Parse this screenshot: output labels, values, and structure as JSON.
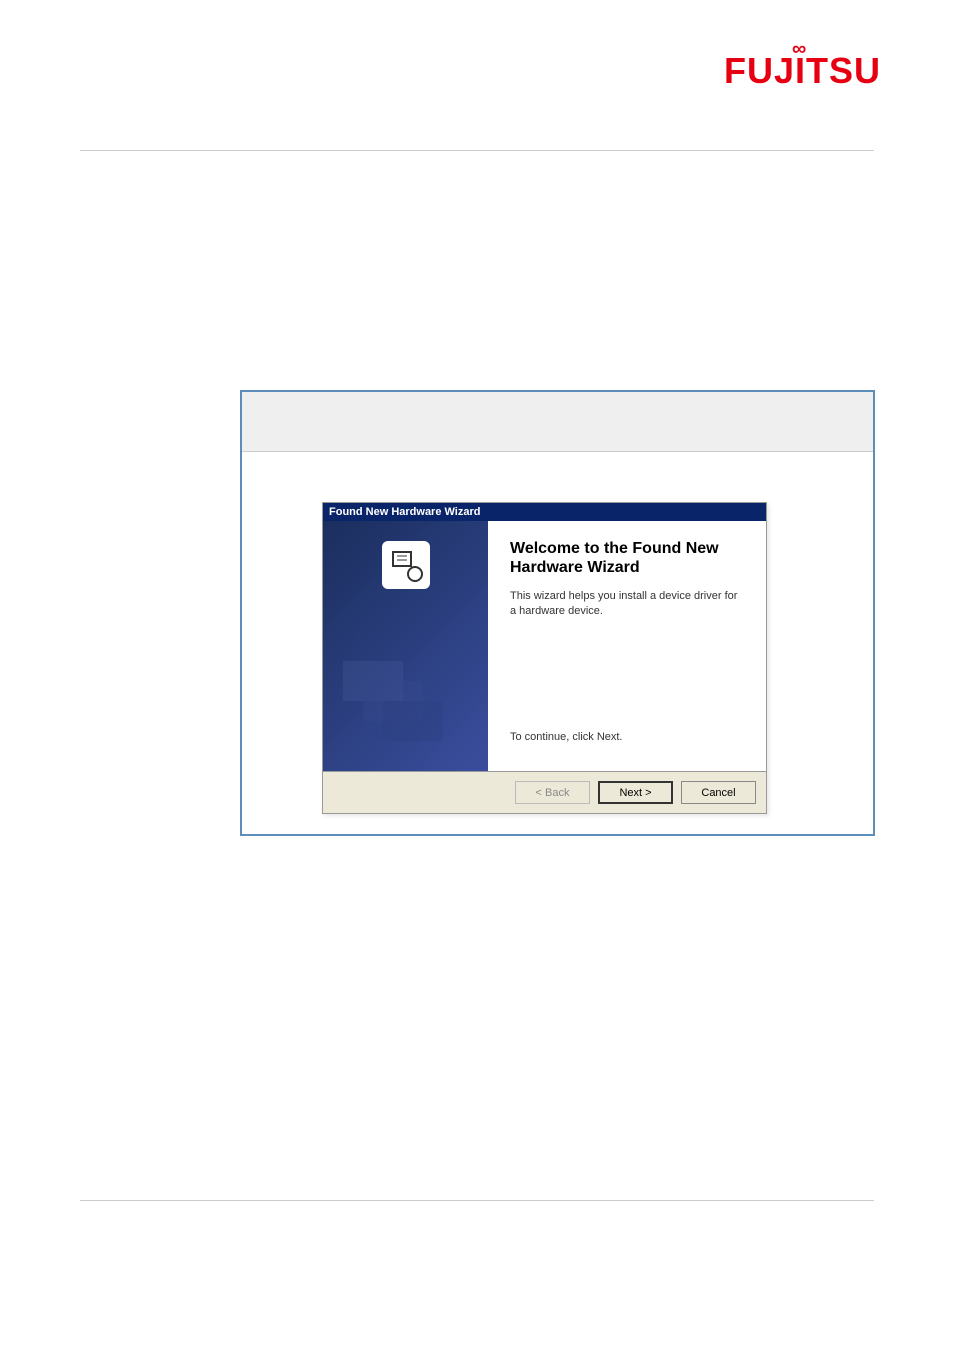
{
  "logo": {
    "text": "FUJITSU"
  },
  "wizard": {
    "titlebar": "Found New Hardware Wizard",
    "heading": "Welcome to the Found New Hardware Wizard",
    "description": "This wizard helps you install a device driver for a hardware device.",
    "continue_text": "To continue, click Next.",
    "buttons": {
      "back": "< Back",
      "next": "Next >",
      "cancel": "Cancel"
    }
  }
}
